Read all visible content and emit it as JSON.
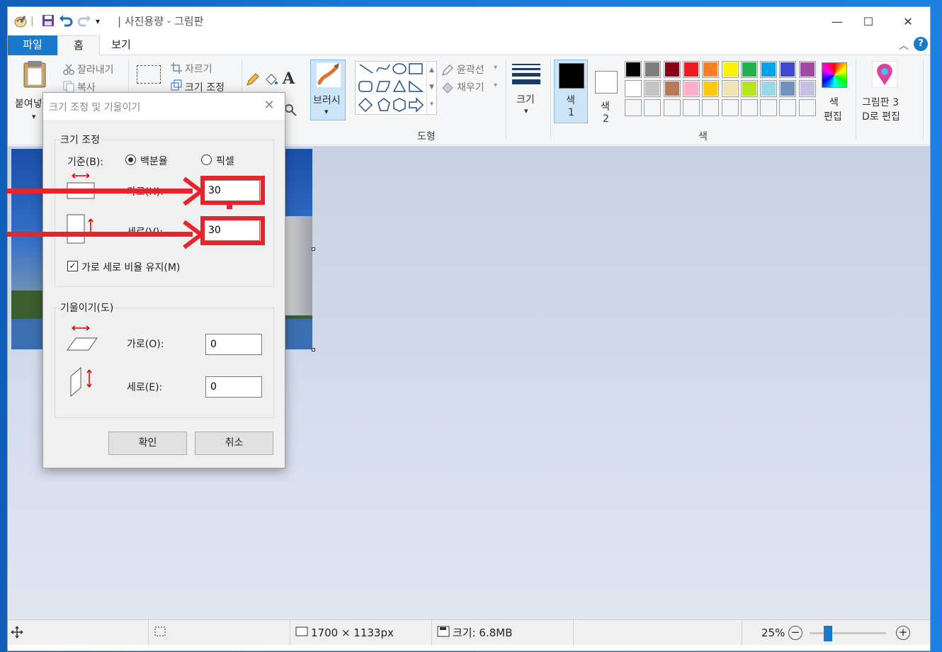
{
  "window": {
    "title": "| 사진용량 - 그림판",
    "controls": {
      "minimize": "—",
      "maximize": "☐",
      "close": "✕"
    }
  },
  "quick_access": {
    "separator": "|",
    "dropdown": "▾"
  },
  "tabs": [
    {
      "label": "파일"
    },
    {
      "label": "홈"
    },
    {
      "label": "보기"
    }
  ],
  "ribbon": {
    "clipboard": {
      "paste": "붙여넣",
      "cut": "잘라내기",
      "copy": "복사",
      "paste_arrow": "▾"
    },
    "image": {
      "crop": "자르기",
      "resize": "크기 조정"
    },
    "brush": {
      "label": "브러시",
      "arrow": "▾"
    },
    "shapes": {
      "outline": "윤곽선",
      "fill": "채우기",
      "group_label": "도형"
    },
    "size": {
      "label": "크기",
      "arrow": "▾"
    },
    "color1": {
      "label_line1": "색",
      "label_line2": "1"
    },
    "color2": {
      "label_line1": "색",
      "label_line2": "2"
    },
    "edit_colors": {
      "label_line1": "색",
      "label_line2": "편집"
    },
    "paint3d": {
      "label_line1": "그림판 3",
      "label_line2": "D로 편집"
    },
    "colors_group_label": "색",
    "palette_row1": [
      "#000000",
      "#7f7f7f",
      "#880015",
      "#ed1c24",
      "#ff7f27",
      "#fff200",
      "#22b14c",
      "#00a2e8",
      "#3f48cc",
      "#a349a4"
    ],
    "palette_row2": [
      "#ffffff",
      "#c3c3c3",
      "#b97a57",
      "#ffaec9",
      "#ffc90e",
      "#efe4b0",
      "#b5e61d",
      "#99d9ea",
      "#7092be",
      "#c8bfe7"
    ]
  },
  "dialog": {
    "title": "크기 조정 및 기울이기",
    "resize_section": "크기 조정",
    "basis_label": "기준(B):",
    "option_percent": "백분율",
    "option_pixel": "픽셀",
    "horizontal_label": "가로(H):",
    "horizontal_value": "30",
    "vertical_label": "세로(V):",
    "vertical_value": "30",
    "keep_ratio": "가로 세로 비율 유지(M)",
    "keep_ratio_checked": "✓",
    "skew_section": "기울이기(도)",
    "skew_h_label": "가로(O):",
    "skew_h_value": "0",
    "skew_v_label": "세로(E):",
    "skew_v_value": "0",
    "ok": "확인",
    "cancel": "취소"
  },
  "statusbar": {
    "dimensions": "1700 × 1133px",
    "filesize": "크기: 6.8MB",
    "zoom": "25%",
    "zoom_out": "−",
    "zoom_in": "+"
  },
  "zoom_level": 0.25,
  "accent_color": "#1979ca",
  "annotation_color": "#e8232b"
}
